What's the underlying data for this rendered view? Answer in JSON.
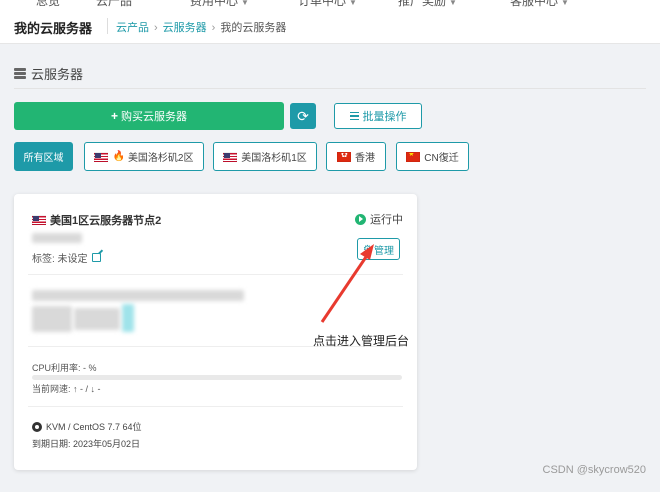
{
  "top_nav": {
    "items": [
      "总览",
      "云产品",
      "费用中心",
      "订单中心",
      "推广奖励",
      "客服中心"
    ]
  },
  "header": {
    "page_title": "我的云服务器",
    "breadcrumb": [
      "云产品",
      "云服务器",
      "我的云服务器"
    ]
  },
  "section": {
    "title": "云服务器",
    "icon": "server-icon"
  },
  "actions": {
    "buy_label": "购买云服务器",
    "refresh_icon": "refresh-icon",
    "batch_label": "批量操作"
  },
  "regions": [
    {
      "label": "所有区域",
      "flag": "",
      "active": true
    },
    {
      "label": "美国洛杉矶2区",
      "flag": "us",
      "hot": true,
      "active": false
    },
    {
      "label": "美国洛杉矶1区",
      "flag": "us",
      "active": false
    },
    {
      "label": "香港",
      "flag": "hk",
      "active": false
    },
    {
      "label": "CN復迁",
      "flag": "cn",
      "active": false
    }
  ],
  "server_card": {
    "name": "美国1区云服务器节点2",
    "status": "运行中",
    "status_color": "#22b573",
    "tag_label": "标签: 未设定",
    "manage_label": "管理",
    "cpu_label": "CPU利用率: - %",
    "cpu_usage": 0,
    "net_label": "当前网速: ↑ - / ↓ -",
    "os": "KVM / CentOS 7.7 64位",
    "expiry": "到期日期: 2023年05月02日"
  },
  "annotation": {
    "text": "点击进入管理后台",
    "arrow_color": "#e83a2f"
  },
  "watermark": "CSDN @skycrow520",
  "colors": {
    "accent": "#1e9aa8",
    "success": "#22b573"
  }
}
